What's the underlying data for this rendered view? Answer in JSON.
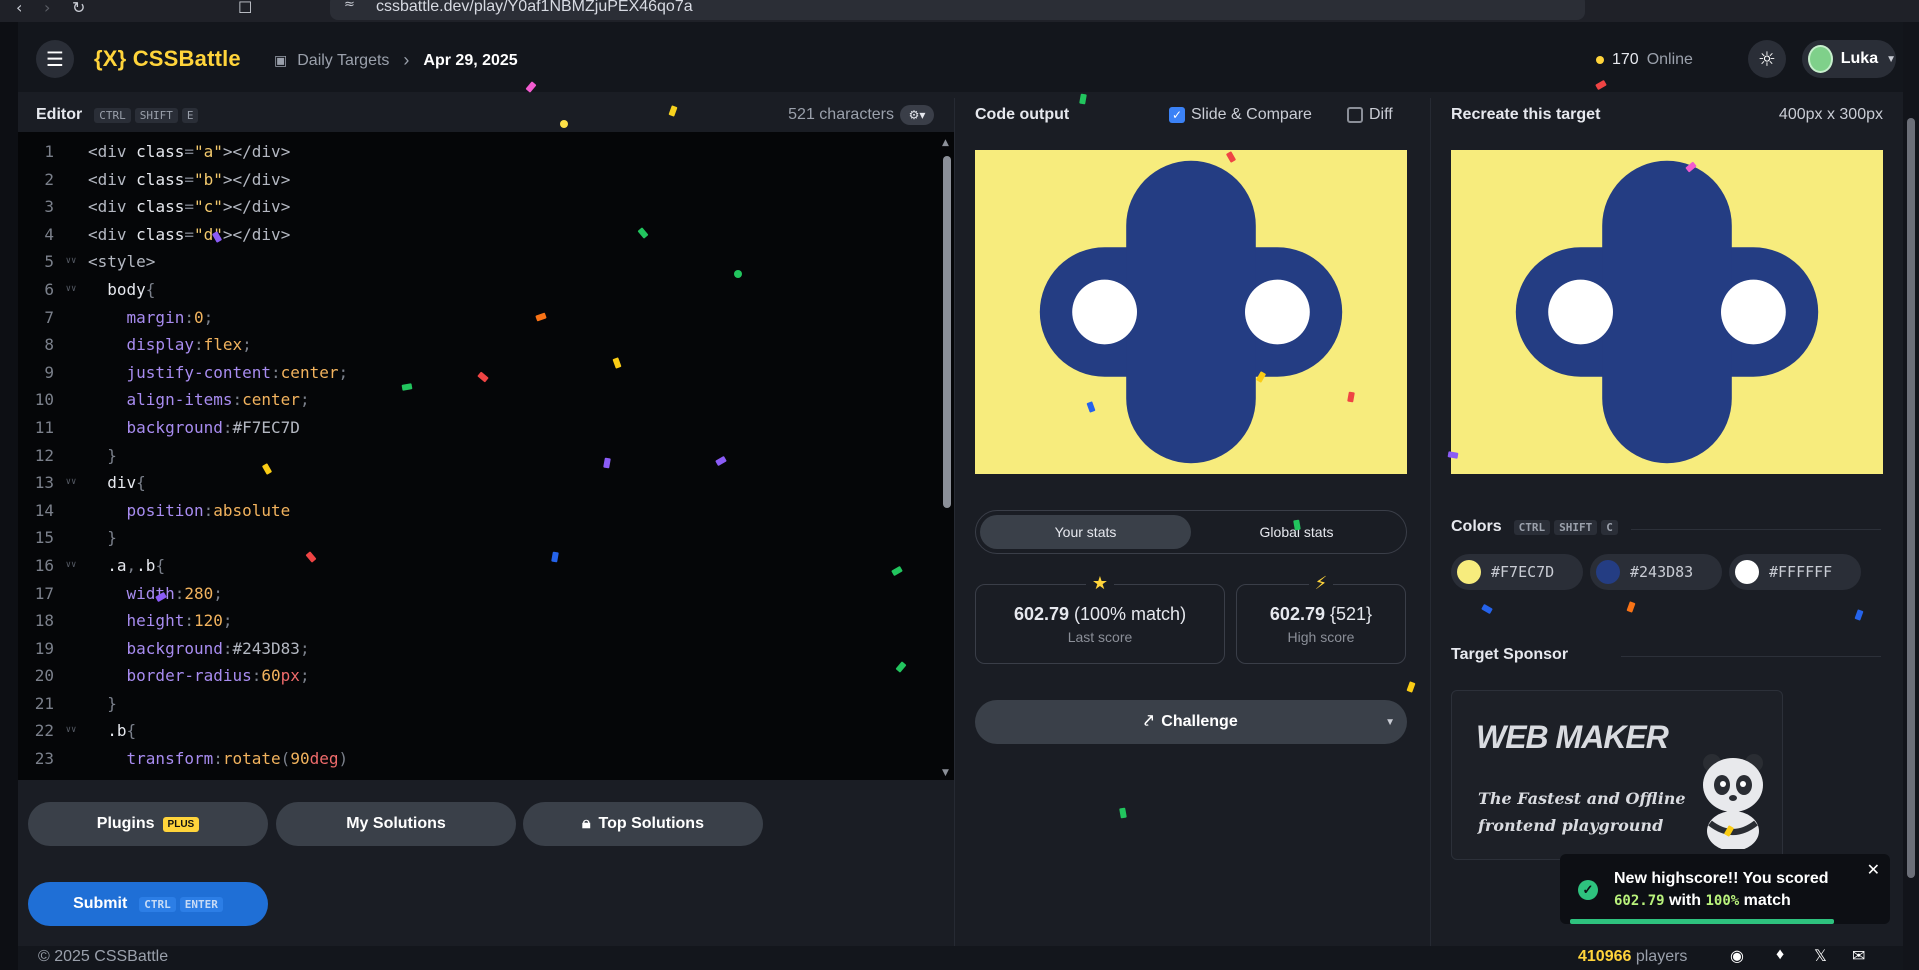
{
  "browser": {
    "url": "cssbattle.dev/play/Y0af1NBMZjuPEX46qo7a"
  },
  "header": {
    "logo": "{X} CSSBattle",
    "crumb_link": "Daily Targets",
    "crumb_current": "Apr 29, 2025",
    "online_count": "170",
    "online_label": "Online",
    "user_name": "Luka"
  },
  "editor": {
    "title": "Editor",
    "shortcut": [
      "CTRL",
      "SHIFT",
      "E"
    ],
    "characters": "521 characters",
    "lines": [
      [
        {
          "t": "<div ",
          "c": "tag"
        },
        {
          "t": "class",
          "c": "attr"
        },
        {
          "t": "=",
          "c": "punc"
        },
        {
          "t": "\"a\"",
          "c": "str"
        },
        {
          "t": "></div>",
          "c": "tag"
        }
      ],
      [
        {
          "t": "<div ",
          "c": "tag"
        },
        {
          "t": "class",
          "c": "attr"
        },
        {
          "t": "=",
          "c": "punc"
        },
        {
          "t": "\"b\"",
          "c": "str"
        },
        {
          "t": "></div>",
          "c": "tag"
        }
      ],
      [
        {
          "t": "<div ",
          "c": "tag"
        },
        {
          "t": "class",
          "c": "attr"
        },
        {
          "t": "=",
          "c": "punc"
        },
        {
          "t": "\"c\"",
          "c": "str"
        },
        {
          "t": "></div>",
          "c": "tag"
        }
      ],
      [
        {
          "t": "<div ",
          "c": "tag"
        },
        {
          "t": "class",
          "c": "attr"
        },
        {
          "t": "=",
          "c": "punc"
        },
        {
          "t": "\"d\"",
          "c": "str"
        },
        {
          "t": "></div>",
          "c": "tag"
        }
      ],
      [
        {
          "t": "<style>",
          "c": "tag"
        }
      ],
      [
        {
          "t": "  body",
          "c": "sel"
        },
        {
          "t": "{",
          "c": "punc"
        }
      ],
      [
        {
          "t": "    margin",
          "c": "prop"
        },
        {
          "t": ":",
          "c": "punc"
        },
        {
          "t": "0",
          "c": "num"
        },
        {
          "t": ";",
          "c": "punc"
        }
      ],
      [
        {
          "t": "    display",
          "c": "prop"
        },
        {
          "t": ":",
          "c": "punc"
        },
        {
          "t": "flex",
          "c": "val"
        },
        {
          "t": ";",
          "c": "punc"
        }
      ],
      [
        {
          "t": "    justify-content",
          "c": "prop"
        },
        {
          "t": ":",
          "c": "punc"
        },
        {
          "t": "center",
          "c": "val"
        },
        {
          "t": ";",
          "c": "punc"
        }
      ],
      [
        {
          "t": "    align-items",
          "c": "prop"
        },
        {
          "t": ":",
          "c": "punc"
        },
        {
          "t": "center",
          "c": "val"
        },
        {
          "t": ";",
          "c": "punc"
        }
      ],
      [
        {
          "t": "    background",
          "c": "prop"
        },
        {
          "t": ":",
          "c": "punc"
        },
        {
          "t": "#F7EC7D",
          "c": "tag"
        }
      ],
      [
        {
          "t": "  }",
          "c": "punc"
        }
      ],
      [
        {
          "t": "  div",
          "c": "sel"
        },
        {
          "t": "{",
          "c": "punc"
        }
      ],
      [
        {
          "t": "    position",
          "c": "prop"
        },
        {
          "t": ":",
          "c": "punc"
        },
        {
          "t": "absolute",
          "c": "val"
        }
      ],
      [
        {
          "t": "  }",
          "c": "punc"
        }
      ],
      [
        {
          "t": "  .a",
          "c": "sel"
        },
        {
          "t": ",",
          "c": "punc"
        },
        {
          "t": ".b",
          "c": "sel"
        },
        {
          "t": "{",
          "c": "punc"
        }
      ],
      [
        {
          "t": "    width",
          "c": "prop"
        },
        {
          "t": ":",
          "c": "punc"
        },
        {
          "t": "280",
          "c": "num"
        },
        {
          "t": ";",
          "c": "punc"
        }
      ],
      [
        {
          "t": "    height",
          "c": "prop"
        },
        {
          "t": ":",
          "c": "punc"
        },
        {
          "t": "120",
          "c": "num"
        },
        {
          "t": ";",
          "c": "punc"
        }
      ],
      [
        {
          "t": "    background",
          "c": "prop"
        },
        {
          "t": ":",
          "c": "punc"
        },
        {
          "t": "#243D83",
          "c": "tag"
        },
        {
          "t": ";",
          "c": "punc"
        }
      ],
      [
        {
          "t": "    border-radius",
          "c": "prop"
        },
        {
          "t": ":",
          "c": "punc"
        },
        {
          "t": "60",
          "c": "num"
        },
        {
          "t": "px",
          "c": "unit"
        },
        {
          "t": ";",
          "c": "punc"
        }
      ],
      [
        {
          "t": "  }",
          "c": "punc"
        }
      ],
      [
        {
          "t": "  .b",
          "c": "sel"
        },
        {
          "t": "{",
          "c": "punc"
        }
      ],
      [
        {
          "t": "    transform",
          "c": "prop"
        },
        {
          "t": ":",
          "c": "punc"
        },
        {
          "t": "rotate",
          "c": "val"
        },
        {
          "t": "(",
          "c": "punc"
        },
        {
          "t": "90",
          "c": "num"
        },
        {
          "t": "deg",
          "c": "unit"
        },
        {
          "t": ")",
          "c": "punc"
        }
      ],
      [
        {
          "t": "  }",
          "c": "punc"
        }
      ]
    ],
    "folds": [
      5,
      6,
      13,
      16,
      22
    ]
  },
  "buttons": {
    "plugins": "Plugins",
    "plugins_badge": "PLUS",
    "my_solutions": "My Solutions",
    "top_solutions": "Top Solutions",
    "submit": "Submit",
    "submit_shortcut": [
      "CTRL",
      "ENTER"
    ]
  },
  "output": {
    "title": "Code output",
    "slide_compare": "Slide & Compare",
    "diff": "Diff",
    "tab_your": "Your stats",
    "tab_global": "Global stats",
    "last_score_value": "602.79",
    "last_score_extra": "(100% match)",
    "last_score_label": "Last score",
    "high_score_value": "602.79",
    "high_score_extra": "{521}",
    "high_score_label": "High score",
    "challenge": "Challenge"
  },
  "target": {
    "title": "Recreate this target",
    "size": "400px x 300px",
    "colors_title": "Colors",
    "colors_shortcut": [
      "CTRL",
      "SHIFT",
      "C"
    ],
    "colors": [
      "#F7EC7D",
      "#243D83",
      "#FFFFFF"
    ],
    "sponsor_title": "Target Sponsor",
    "sponsor_name": "WEB MAKER",
    "sponsor_tagline": "The Fastest and Offline frontend playground"
  },
  "toast": {
    "line1": "New highscore!! You scored",
    "score": "602.79",
    "with": "with",
    "match": "100%",
    "match_label": "match"
  },
  "footer": {
    "copyright": "© 2025 CSSBattle",
    "players_count": "410966",
    "players_label": "players"
  },
  "theme": {
    "accent": "#FFD43B",
    "bg_yellow": "#F7EC7D",
    "blue": "#243D83",
    "white": "#FFFFFF",
    "submit_blue": "#1F6FD6"
  }
}
